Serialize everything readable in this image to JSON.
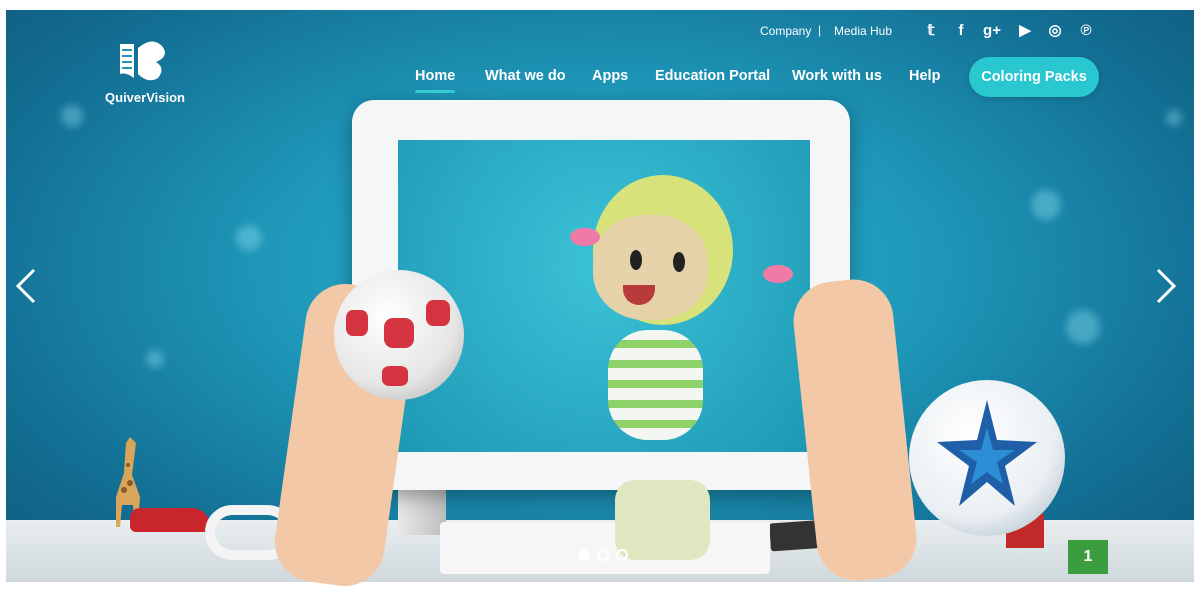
{
  "brand": {
    "name": "QuiverVision"
  },
  "top_links": {
    "company": "Company",
    "separator": "|",
    "media_hub": "Media Hub"
  },
  "social": [
    {
      "icon": "twitter-icon",
      "glyph": "𝕥"
    },
    {
      "icon": "facebook-icon",
      "glyph": "f"
    },
    {
      "icon": "google-plus-icon",
      "glyph": "g+"
    },
    {
      "icon": "youtube-icon",
      "glyph": "▶"
    },
    {
      "icon": "instagram-icon",
      "glyph": "◎"
    },
    {
      "icon": "pinterest-icon",
      "glyph": "℗"
    }
  ],
  "nav": {
    "items": [
      {
        "label": "Home",
        "active": true
      },
      {
        "label": "What we do"
      },
      {
        "label": "Apps"
      },
      {
        "label": "Education Portal"
      },
      {
        "label": "Work with us"
      },
      {
        "label": "Help"
      }
    ],
    "cta": "Coloring Packs"
  },
  "carousel": {
    "slide_count": 3,
    "active_slide": 1,
    "prev_icon": "chevron-left-icon",
    "next_icon": "chevron-right-icon"
  },
  "colors": {
    "accent": "#29c8d0",
    "hero_bg": "#1e97b8",
    "text": "#ffffff"
  }
}
